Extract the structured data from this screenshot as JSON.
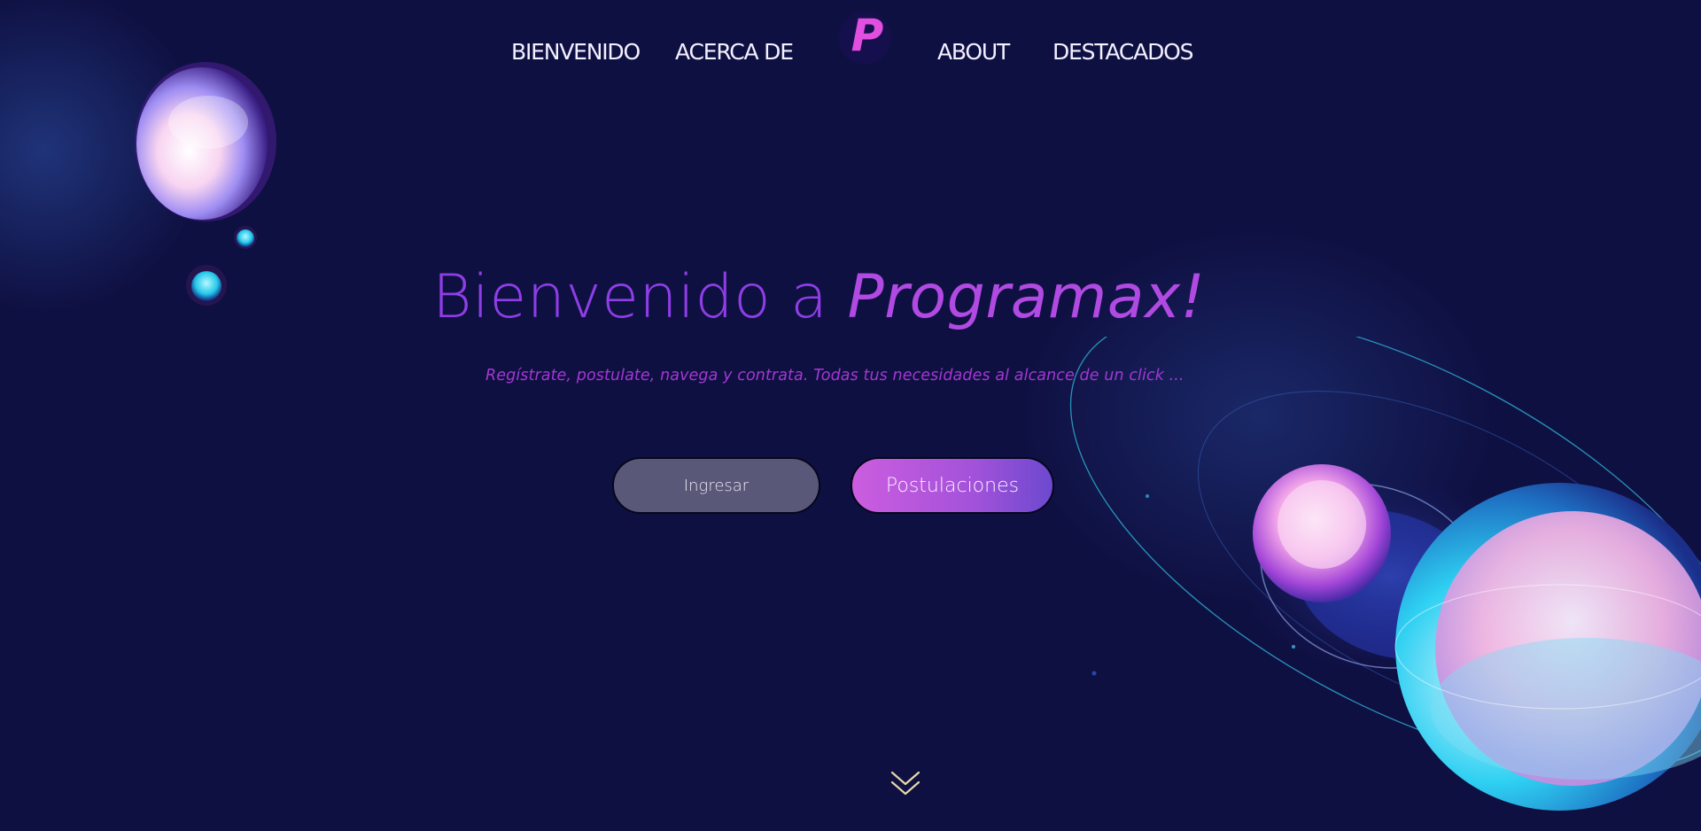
{
  "brand": {
    "logo_letter": "P",
    "accent": "#e24ee0",
    "background": "#0f1042"
  },
  "nav": {
    "items": [
      {
        "label": "BIENVENIDO"
      },
      {
        "label": "ACERCA DE"
      },
      {
        "label": "ABOUT"
      },
      {
        "label": "DESTACADOS"
      }
    ]
  },
  "hero": {
    "title_prefix": "Bienvenido a ",
    "title_brand": "Programax!",
    "subtitle": "Regístrate, postulate, navega y contrata. Todas tus necesidades al alcance de un click ...",
    "buttons": {
      "login": "Ingresar",
      "applications": "Postulaciones"
    }
  },
  "icons": {
    "scroll": "double-chevron-down-icon",
    "decor": "glass-sphere-icon"
  }
}
